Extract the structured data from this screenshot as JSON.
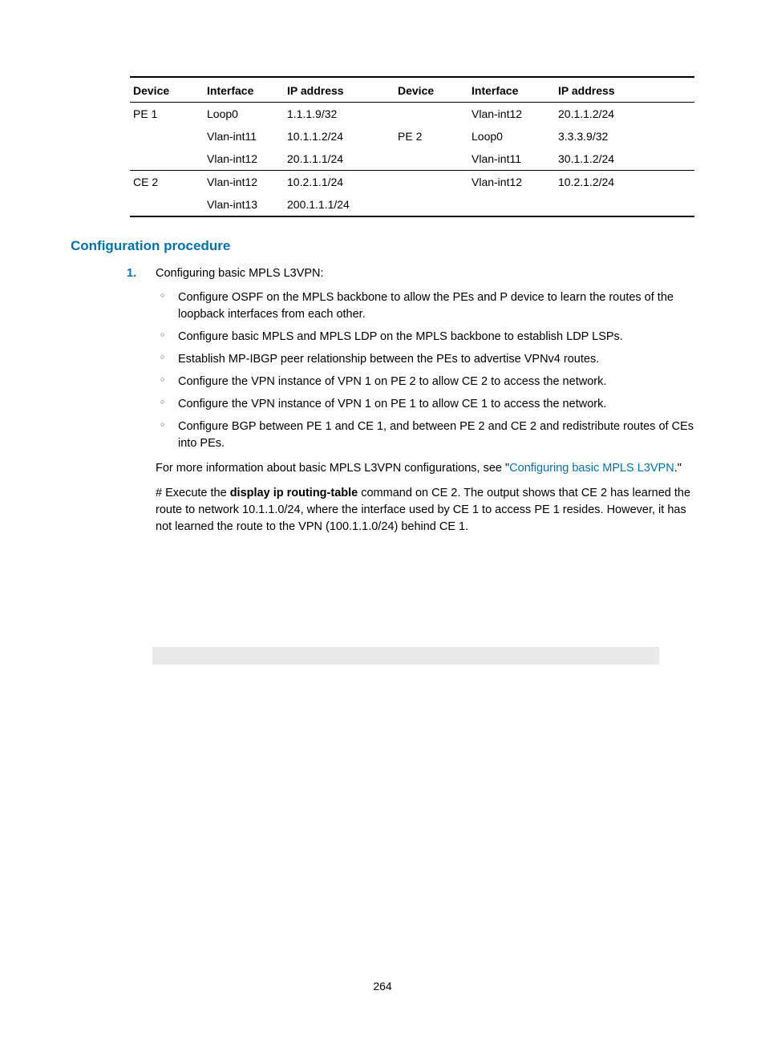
{
  "table": {
    "headers": [
      "Device",
      "Interface",
      "IP address",
      "Device",
      "Interface",
      "IP address"
    ],
    "rows": [
      {
        "cells": [
          "PE 1",
          "Loop0",
          "1.1.1.9/32",
          "",
          "Vlan-int12",
          "20.1.1.2/24"
        ],
        "border": false
      },
      {
        "cells": [
          "",
          "Vlan-int11",
          "10.1.1.2/24",
          "PE 2",
          "Loop0",
          "3.3.3.9/32"
        ],
        "border": false
      },
      {
        "cells": [
          "",
          "Vlan-int12",
          "20.1.1.1/24",
          "",
          "Vlan-int11",
          "30.1.1.2/24"
        ],
        "border": true
      },
      {
        "cells": [
          "CE 2",
          "Vlan-int12",
          "10.2.1.1/24",
          "",
          "Vlan-int12",
          "10.2.1.2/24"
        ],
        "border": false
      },
      {
        "cells": [
          "",
          "Vlan-int13",
          "200.1.1.1/24",
          "",
          "",
          ""
        ],
        "border": "last"
      }
    ]
  },
  "section_heading": "Configuration procedure",
  "step_number": "1.",
  "step_text": "Configuring basic MPLS L3VPN:",
  "bullets": [
    "Configure OSPF on the MPLS backbone to allow the PEs and P device to learn the routes of the loopback interfaces from each other.",
    "Configure basic MPLS and MPLS LDP on the MPLS backbone to establish LDP LSPs.",
    "Establish MP-IBGP peer relationship between the PEs to advertise VPNv4 routes.",
    "Configure the VPN instance of VPN 1 on PE 2 to allow CE 2 to access the network.",
    "Configure the VPN instance of VPN 1 on PE 1 to allow CE 1 to access the network.",
    "Configure BGP between PE 1 and CE 1, and between PE 2 and CE 2 and redistribute routes of CEs into PEs."
  ],
  "more_info_prefix": "For more information about basic MPLS L3VPN configurations, see \"",
  "more_info_link": "Configuring basic MPLS L3VPN",
  "more_info_suffix": ".\"",
  "exec_prefix": "# Execute the ",
  "exec_bold": "display ip routing-table",
  "exec_suffix": " command on CE 2. The output shows that CE 2 has learned the route to network 10.1.1.0/24, where the interface used by CE 1 to access PE 1 resides. However, it has not learned the route to the VPN (100.1.1.0/24) behind CE 1.",
  "page_number": "264"
}
